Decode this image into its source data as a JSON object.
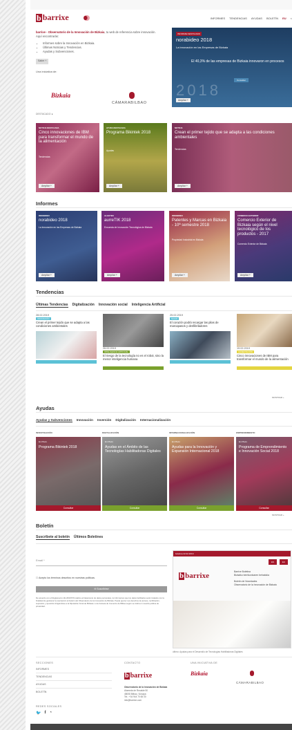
{
  "header": {
    "brand": "barrixe",
    "brand_mark": "b",
    "nav": [
      "INFORMES",
      "TENDENCIAS",
      "AYUDAS",
      "BOLETÍN",
      "EU"
    ],
    "nav_active_index": 4
  },
  "intro": {
    "lead_brand": "barrixe - Observatorio de la Innovación de Bizkaia",
    "lead_text": ", tu web de referencia sobre innovación.",
    "lead_sub": "Aquí encontrarás:",
    "bullets": [
      "Informes sobre la Innovación en Bizkaia.",
      "Últimas Noticias y Tendencias.",
      "Ayudas y Subvenciones."
    ],
    "more_button": "Saber +",
    "sponsor_label": "Una iniciativa de:",
    "bizkaia": "Bizkaia",
    "camara": "CÁMARABILBAO"
  },
  "hero": {
    "tag": "INFORME DESTACADO",
    "title": "norabideo 2018",
    "subtitle": "La innovación en las Empresas de Bizkaia",
    "quote": "El 40,3% de las empresas de Bizkaia innovaron en procesos",
    "year": "2018",
    "consult": "Consultar",
    "button": "Ampliar +"
  },
  "featured": {
    "label": "DESTACADO",
    "cards": [
      {
        "tag": "NOTICIA DESTACADA",
        "title": "Cinco innovaciones de IBM para transformar el mundo de la alimentación",
        "sub": "Tendencias",
        "button": "Ampliar +"
      },
      {
        "tag": "AYUDA DESTACADA",
        "title": "Programa Bikintek 2018",
        "sub": "Ayudas",
        "button": "Ampliar +"
      },
      {
        "tag": "NOTICIA",
        "title": "Crean el primer tejido que se adapta a las condiciones ambientales",
        "sub": "Tendencias",
        "button": "Ampliar +"
      }
    ]
  },
  "reports": {
    "title": "Informes",
    "cards": [
      {
        "tag": "INNOBIDEO",
        "title": "norabideo 2018",
        "sub": "La Innovación en las Empresas de Bizkaia",
        "button": "Ampliar +"
      },
      {
        "tag": "ALGO?EN",
        "title": "aurreTIK 2018",
        "sub": "Encuesta de Innovación Tecnológica de Bizkaia",
        "button": "Ampliar +"
      },
      {
        "tag": "INNOBIDEO",
        "title": "Patentes y Marcas en Bizkaia - 10ª semestre 2018",
        "sub": "Propiedad Industrial en Bizkaia",
        "button": "Ampliar +"
      },
      {
        "tag": "COMERCIO EXTERIOR",
        "title": "Comercio Exterior de Bizkaia según el nivel tecnológico de los productos - 2017",
        "sub": "Comercio Exterior de Bizkaia",
        "button": "Ampliar +"
      }
    ]
  },
  "trends": {
    "title": "Tendencias",
    "tabs": [
      "Últimas Tendencias",
      "Digitalización",
      "Innovación social",
      "Inteligencia Artificial"
    ],
    "items": [
      {
        "date": "28.02.2019",
        "badge": "INNOVACIÓN",
        "title": "Crean el primer tejido que se adapta a las condiciones ambientales",
        "bar": "Leer +"
      },
      {
        "date": "26.02.2019",
        "badge": "INTELIGENCIA ARTIFICIAL",
        "title": "El riesgo de la tecnología no es el robot, sino la menor inteligencia humana",
        "bar": "Leer +"
      },
      {
        "date": "25.02.2019",
        "badge": "SALUD",
        "title": "El corazón podrá recargar las pilas de marcapasos y desfibriladores",
        "bar": "Leer +"
      },
      {
        "date": "19.02.2019",
        "badge": "ALIMENTACIÓN",
        "title": "Cinco innovaciones de IBM para transformar el mundo de la alimentación",
        "bar": "Leer +"
      }
    ],
    "more": "MOSTRAR +"
  },
  "aids": {
    "title": "Ayudas",
    "tabs": [
      "Ayudas y Subvenciones",
      "Innovación",
      "Inversión",
      "Digitalización",
      "Internacionalización"
    ],
    "items": [
      {
        "top": "INVESTIGACIÓN",
        "lab": "En Plazo",
        "title": "Programa Bikintek 2018",
        "button": "Consultar"
      },
      {
        "top": "DIGITALIZACIÓN",
        "lab": "En Plazo",
        "title": "Ayudas en el Ámbito de las Tecnologías Habilitadoras Digitales",
        "button": "Consultar"
      },
      {
        "top": "INTERNACIONALIZACIÓN",
        "lab": "En Plazo",
        "title": "Ayudas para la Innovación y Expansión Internacional 2018",
        "button": "Consultar"
      },
      {
        "top": "EMPRENDIMIENTO",
        "lab": "En Plazo",
        "title": "Programa de Emprendimiento e Innovación Social 2018",
        "button": "Consultar"
      }
    ],
    "more": "MOSTRAR +"
  },
  "newsletter": {
    "title": "Boletín",
    "tabs": [
      "Suscríbete al boletín",
      "Últimos Boletines"
    ],
    "email_label": "Email *",
    "accept": "Acepto los términos descritos en nuestras políticas.",
    "subscribe": "Suscribirse",
    "legal": "De acuerdo con el Reglamento UE 2016/679 relativo al tratamiento de datos personales, le informamos que los datos facilitados serán tratados con la finalidad de gestionar la suscripción al boletín del Observatorio de la Innovación de Bizkaia. Puede ejercer sus derechos de acceso, rectificación, supresión y oposición dirigiéndose a la Diputación Foral de Bizkaia o a la Cámara de Comercio de Bilbao según se indica en nuestra política de privacidad.",
    "preview_head": "boletina 22.02.2019",
    "preview_es": "ES",
    "preview_eu": "EU",
    "preview_title": "Barrixe Boletina\nBizkaiko berrikuntzaren behatokia\n\nBoletín de Novedades\nObservatorio de la Innovación de Bizkaia",
    "preview_caption": "último: Ayudas para el Desarrollo de Tecnologías Habilitadoras Digitales"
  },
  "footer": {
    "sections_h": "SECCIONES",
    "sections": [
      "INFORMES",
      "TENDENCIAS",
      "AYUDAS",
      "BOLETÍN"
    ],
    "social_h": "REDES SOCIALES",
    "social": [
      "twitter",
      "facebook",
      "rss"
    ],
    "contact_h": "CONTACTO",
    "contact_name": "Observatorio de la Innovación de Bizkaia",
    "contact_lines": [
      "Alameda de Recalde 50",
      "48008 Bilbao, Vizcaya",
      "Tel.: +34 944 70 65 00",
      "info@barrixe.com"
    ],
    "initiative_h": "UNA INICIATIVA DE"
  },
  "colors": {
    "brand": "#a4192c",
    "teal": "#5cc1d6",
    "green": "#7aa12d",
    "yellow": "#e4d541"
  }
}
